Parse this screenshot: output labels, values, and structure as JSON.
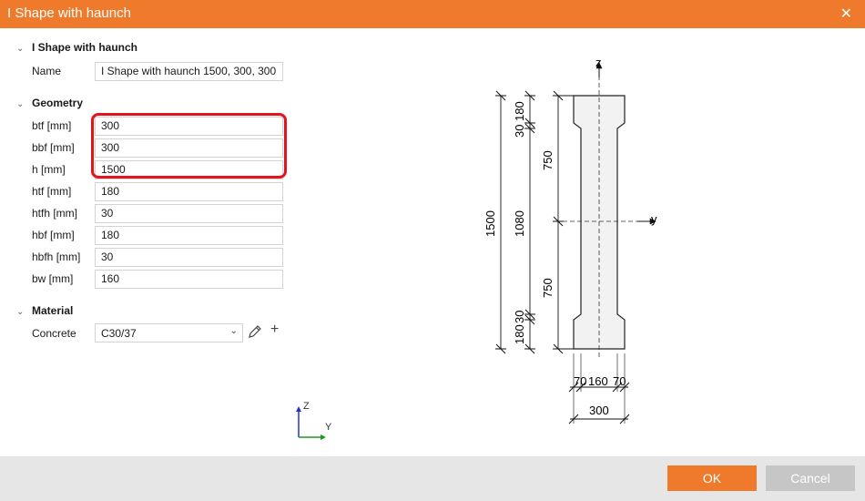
{
  "window": {
    "title": "I Shape with haunch",
    "close_icon": "close-icon"
  },
  "header_section": {
    "title": "I Shape with haunch",
    "name_label": "Name",
    "name_value": "I Shape with haunch 1500, 300, 300"
  },
  "geometry": {
    "title": "Geometry",
    "fields": [
      {
        "label": "btf [mm]",
        "value": "300"
      },
      {
        "label": "bbf [mm]",
        "value": "300"
      },
      {
        "label": "h [mm]",
        "value": "1500"
      },
      {
        "label": "htf [mm]",
        "value": "180"
      },
      {
        "label": "htfh [mm]",
        "value": "30"
      },
      {
        "label": "hbf [mm]",
        "value": "180"
      },
      {
        "label": "hbfh [mm]",
        "value": "30"
      },
      {
        "label": "bw [mm]",
        "value": "160"
      }
    ]
  },
  "material": {
    "title": "Material",
    "concrete_label": "Concrete",
    "concrete_value": "C30/37",
    "edit_icon": "pencil-icon",
    "add_icon": "plus-icon"
  },
  "local_axes": {
    "z": "Z",
    "y": "Y"
  },
  "drawing": {
    "axis_z": "z",
    "axis_y": "y",
    "dim_total_height": "1500",
    "dim_top_flange": "180",
    "dim_top_haunch": "30",
    "dim_web": "1080",
    "dim_bottom_haunch": "30",
    "dim_bottom_flange": "180",
    "dim_upper_half": "750",
    "dim_lower_half": "750",
    "dim_left_overhang": "70",
    "dim_web_width": "160",
    "dim_right_overhang": "70",
    "dim_total_width": "300"
  },
  "footer": {
    "ok_label": "OK",
    "cancel_label": "Cancel"
  },
  "colors": {
    "accent": "#f07a2b",
    "highlight": "#e3141b",
    "footer": "#e6e6e6"
  }
}
